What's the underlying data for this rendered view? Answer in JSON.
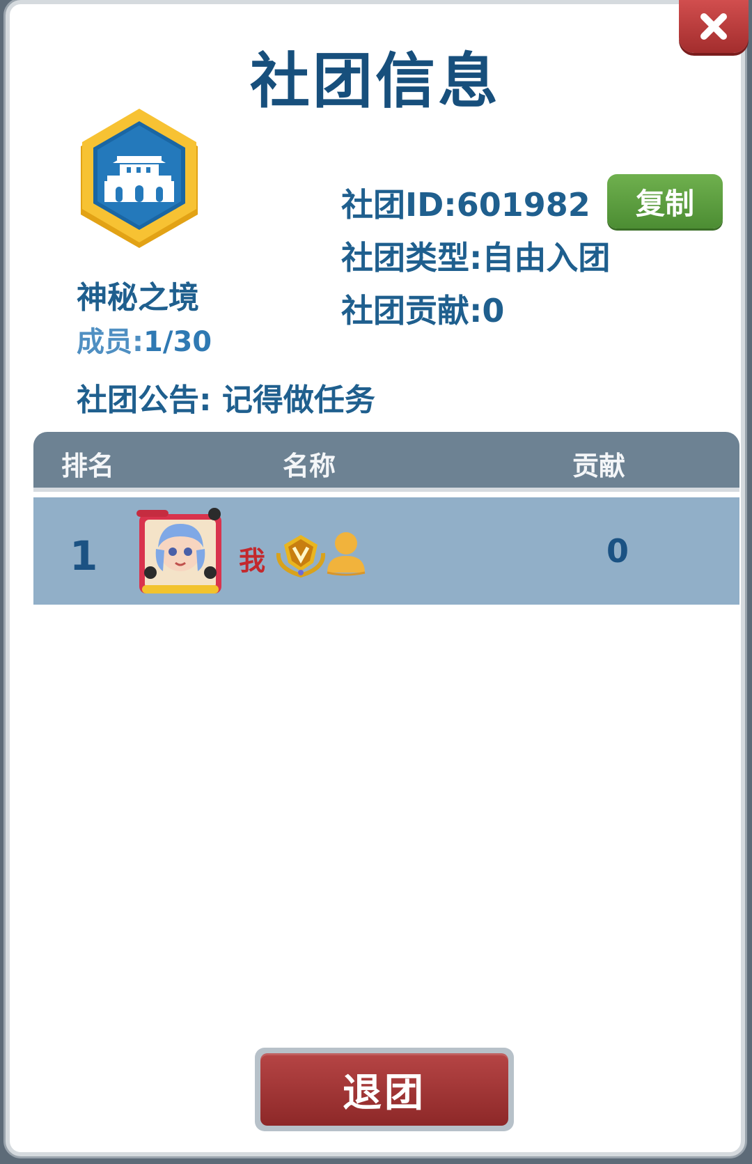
{
  "dialog": {
    "title": "社团信息",
    "close_icon": "close-icon"
  },
  "club": {
    "emblem_icon": "city-gate-emblem-icon",
    "name": "神秘之境",
    "members_label": "成员:",
    "members_value": "1/30",
    "id_text": "社团ID:601982",
    "copy_label": "复制",
    "type_text": "社团类型:自由入团",
    "contribution_text": "社团贡献:0",
    "notice_text": "社团公告: 记得做任务"
  },
  "table": {
    "headers": [
      "排名",
      "名称",
      "贡献"
    ],
    "rows": [
      {
        "rank": "1",
        "avatar_icon": "player-avatar-icon",
        "name": "我",
        "vip_icon": "vip-badge-icon",
        "person_icon": "person-icon",
        "contribution": "0"
      }
    ]
  },
  "footer": {
    "leave_label": "退团"
  },
  "colors": {
    "title": "#174f7c",
    "header_bg": "#6d8293",
    "row_bg": "#91afc8",
    "copy_button": "#5c9e3f",
    "leave_button": "#a33838",
    "close_button": "#bf3e3e"
  }
}
